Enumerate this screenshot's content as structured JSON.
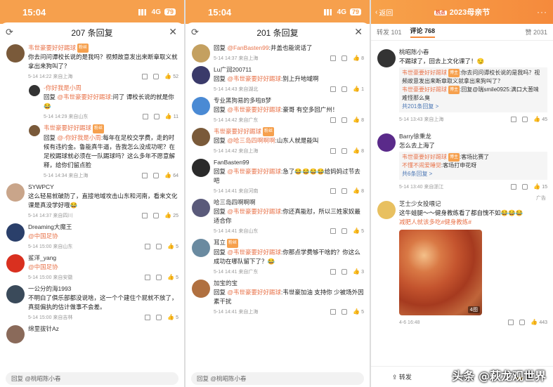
{
  "status": {
    "time": "15:04",
    "network": "4G",
    "battery": "79"
  },
  "panel1": {
    "title": "207 条回复",
    "reply_placeholder": "回复 @桃昭陈小春",
    "comments": [
      {
        "name": "韦世豪要好好踢球",
        "tag": "粉丝",
        "text": "你去问问谭校长说的是我吗？视频故意发出来断章取义就拿出来狗叫了？",
        "time": "5-14 14:22",
        "loc": "来自上海",
        "likes": "52",
        "avatar_color": "#7a5a3a",
        "sub": false,
        "bold": true
      },
      {
        "name": "-你好我是小周",
        "tag": "",
        "text_prefix": "回复 ",
        "link": "@韦世豪要好好踢球",
        "text": ":问了 谭校长说的就是你😂",
        "time": "5-14 14:29",
        "loc": "来自山东",
        "likes": "11",
        "avatar_color": "#333",
        "sub": true,
        "bold": true
      },
      {
        "name": "韦世豪要好好踢球",
        "tag": "粉丝",
        "text_prefix": "回复 ",
        "link": "@-你好我是小周",
        "text": ":每年在足校交学费，走的时候有违约金。鲁能真牛逼，告我怎么没成功呢？在足校踢球就必须在一队踢球吗？这么多年不愿意解释，给你们留点脸",
        "time": "5-14 14:34",
        "loc": "来自上海",
        "likes": "64",
        "avatar_color": "#7a5a3a",
        "sub": true,
        "bold": true
      },
      {
        "name": "SYWPCY",
        "tag": "",
        "text": "这么轻易就破防了，直接地域攻击山东和河南，看来文化课是真没学好哦😂",
        "time": "5-14 14:37",
        "loc": "来自四川",
        "likes": "25",
        "avatar_color": "#c9a58a",
        "sub": false,
        "bold": false
      },
      {
        "name": "Dreaming大魔王",
        "tag": "",
        "text": "@中国足协",
        "is_link": true,
        "time": "5-14 15:00",
        "loc": "来自山东",
        "likes": "5",
        "avatar_color": "#2a3f6a",
        "sub": false,
        "bold": false
      },
      {
        "name": "鲨洋_yang",
        "tag": "",
        "text": "@中国足协",
        "is_link": true,
        "time": "5-14 15:00",
        "loc": "来自安徽",
        "likes": "5",
        "avatar_color": "#d9301f",
        "sub": false,
        "bold": false
      },
      {
        "name": "一公分的海1993",
        "tag": "",
        "text": "不明白了俱乐部都没说啥，这一个个建住个屁就不放了，真挺偏执的估计做事不会差。",
        "time": "5-14 15:00",
        "loc": "来自吉林",
        "likes": "5",
        "avatar_color": "#3a4a5a",
        "sub": false,
        "bold": false
      },
      {
        "name": "绵里拔针Az",
        "tag": "",
        "text": "",
        "time": "",
        "loc": "",
        "likes": "",
        "avatar_color": "#8a6a5a",
        "sub": false,
        "bold": false
      }
    ]
  },
  "panel2": {
    "title": "201 条回复",
    "reply_placeholder": "回复 @桃昭陈小春",
    "comments": [
      {
        "name": "",
        "text_prefix": "回复 ",
        "link": "@FanBasten99",
        "text": ":井盖也能说话了",
        "time": "5-14 14:37",
        "loc": "来自上海",
        "likes": "8",
        "avatar_color": "#c4a060",
        "bold": false
      },
      {
        "name": "Lu广润200711",
        "text_prefix": "回复 ",
        "link": "@韦世豪要好好踢球",
        "text": ":别上升地域啊",
        "time": "5-14 14:43",
        "loc": "来自湖北",
        "likes": "1",
        "avatar_color": "#3a3a6a",
        "bold": false
      },
      {
        "name": "专业黑狗易的多啦B梦",
        "text_prefix": "回复 ",
        "link": "@韦世豪要好好踢球",
        "text": ":豪哥 有空多回广州！",
        "time": "5-14 14:42",
        "loc": "来自广东",
        "likes": "8",
        "avatar_color": "#4a8ad4",
        "bold": false
      },
      {
        "name": "韦世豪要好好踢球",
        "tag": "粉丝",
        "text_prefix": "回复 ",
        "link": "@哈三岛四啊啊啊",
        "text": ":山东人就是能叫",
        "time": "5-14 14:42",
        "loc": "来自上海",
        "likes": "8",
        "avatar_color": "#7a5a3a",
        "bold": true
      },
      {
        "name": "FanBasten99",
        "text_prefix": "回复 ",
        "link": "@韦世豪要好好踢球",
        "text": ":急了😂😂😂😂给妈妈过节去吧",
        "time": "5-14 14:41",
        "loc": "来自河南",
        "likes": "8",
        "avatar_color": "#2a2a2a",
        "bold": false
      },
      {
        "name": "哈三岛四啊啊啊",
        "text_prefix": "回复 ",
        "link": "@韦世豪要好好踢球",
        "text": ":你还真能怼，所以三姓家奴最适合你",
        "time": "5-14 14:41",
        "loc": "来自山东",
        "likes": "5",
        "avatar_color": "#5a5a7a",
        "bold": false
      },
      {
        "name": "耳立",
        "tag": "粉丝",
        "text_prefix": "回复 ",
        "link": "@韦世豪要好好踢球",
        "text": ":你那点学费够干啥的？你这么成功在哪队留下了？😂",
        "time": "5-14 14:41",
        "loc": "来自广东",
        "likes": "3",
        "avatar_color": "#6a8aa0",
        "bold": false
      },
      {
        "name": "加宝的宝",
        "text_prefix": "回复 ",
        "link": "@韦世豪要好好踢球",
        "text": ":韦世豪加油 支持你 少被场外因素干扰",
        "time": "5-14 14:41",
        "loc": "来自上海",
        "likes": "5",
        "avatar_color": "#b07040",
        "bold": false
      }
    ]
  },
  "panel3": {
    "back": "返回",
    "hot": "热点",
    "title": "2023母亲节",
    "tabs": {
      "repost": "转发 101",
      "comment": "评论 768",
      "likes": "赞 2031"
    },
    "comments": [
      {
        "name": "桃昭陈小春",
        "text": "不踢球了，回去上文化课了！😏",
        "quotes": [
          {
            "name": "韦世豪要好好踢球",
            "tag": "博主",
            "text": ":你去问问谭校长说的是我吗？视频故意发出来断章取义就拿出来狗叫了？"
          },
          {
            "name": "韦世豪要好好踢球",
            "tag": "博主",
            "text": ":回复@瑞smile0925:满口大葱味 难怪那么臭"
          }
        ],
        "more": "共201条回复 >",
        "time": "5-14 13:43",
        "loc": "来自上海",
        "likes": "45",
        "avatar_color": "#333"
      },
      {
        "name": "Barry徐秉龙",
        "text": "怎么去上海了",
        "quotes": [
          {
            "name": "韦世豪要好好踢球",
            "tag": "博主",
            "text": ":客场比赛了"
          },
          {
            "name": "不懂不闹爱睡觉",
            "tag": "",
            "text": ":客场打申花呀"
          }
        ],
        "more": "共6条回复 >",
        "time": "5-14 13:40",
        "loc": "来自浙江",
        "likes": "15",
        "avatar_color": "#5a2a8a"
      },
      {
        "name": "芝士少女投喂记",
        "ad": "广告",
        "text": "这牛蛙腿～～健身教练看了都自愧不如😂😂😂",
        "link": "减肥人就该多吃#健身教练#",
        "img_count": "4图",
        "time": "4-6 16:48",
        "likes": "443",
        "avatar_color": "#e8c060"
      }
    ],
    "bottom": {
      "repost": "转发",
      "comment": "评论",
      "like": "赞"
    },
    "watermark": "头条 @萩龙观世界"
  }
}
